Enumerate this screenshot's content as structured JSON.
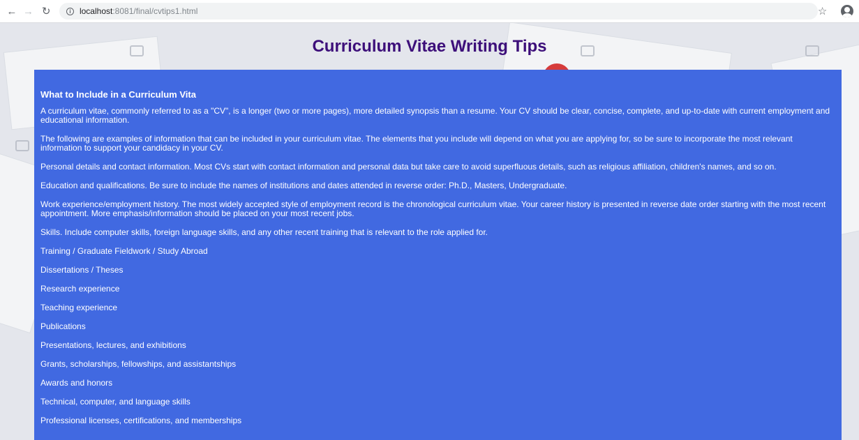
{
  "browser": {
    "url_host": "localhost",
    "url_path": ":8081/final/cvtips1.html"
  },
  "page": {
    "title": "Curriculum Vitae Writing Tips",
    "section_heading": "What to Include in a Curriculum Vita",
    "paragraphs": [
      "A curriculum vitae, commonly referred to as a \"CV\", is a longer (two or more pages), more detailed synopsis than a resume. Your CV should be clear, concise, complete, and up-to-date with current employment and educational information.",
      "The following are examples of information that can be included in your curriculum vitae. The elements that you include will depend on what you are applying for, so be sure to incorporate the most relevant information to support your candidacy in your CV.",
      "Personal details and contact information. Most CVs start with contact information and personal data but take care to avoid superfluous details, such as religious affiliation, children's names, and so on.",
      "Education and qualifications. Be sure to include the names of institutions and dates attended in reverse order: Ph.D., Masters, Undergraduate.",
      "Work experience/employment history. The most widely accepted style of employment record is the chronological curriculum vitae. Your career history is presented in reverse date order starting with the most recent appointment. More emphasis/information should be placed on your most recent jobs.",
      "Skills. Include computer skills, foreign language skills, and any other recent training that is relevant to the role applied for.",
      "Training / Graduate Fieldwork / Study Abroad",
      "Dissertations / Theses",
      "Research experience",
      "Teaching experience",
      "Publications",
      "Presentations, lectures, and exhibitions",
      "Grants, scholarships, fellowships, and assistantships",
      "Awards and honors",
      "Technical, computer, and language skills",
      "Professional licenses, certifications, and memberships"
    ]
  },
  "colors": {
    "content_background": "#4169e1",
    "title_color": "#3d0f7a"
  }
}
